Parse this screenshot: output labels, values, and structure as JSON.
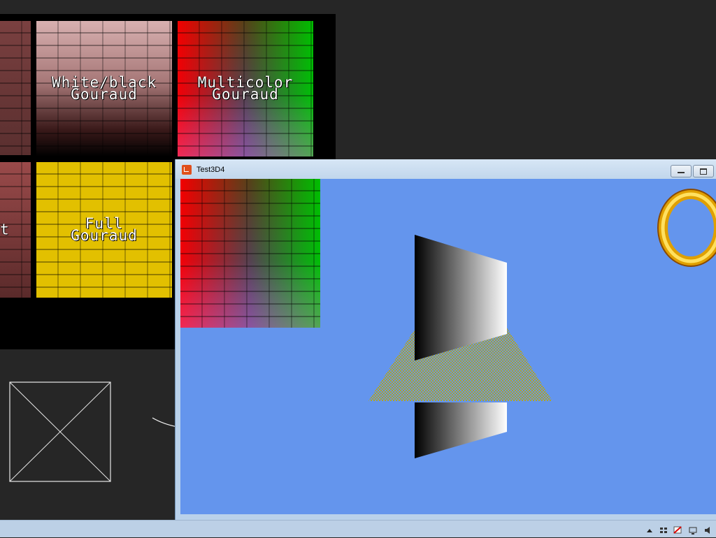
{
  "gallery": {
    "tiles": [
      {
        "id": "partial-top",
        "label": ""
      },
      {
        "id": "white-black",
        "label": "White/black\nGouraud"
      },
      {
        "id": "multicolor",
        "label": "Multicolor\nGouraud"
      },
      {
        "id": "partial-bottom",
        "label": "t"
      },
      {
        "id": "full",
        "label": "Full\nGouraud"
      }
    ]
  },
  "window": {
    "title": "Test3D4",
    "buttons": [
      "minimize",
      "maximize"
    ],
    "viewport_color": "#6495ed"
  },
  "colors": {
    "desktop": "#262626",
    "accent_window": "#b9d1ea",
    "icon_orange": "#e04f1c",
    "checker_a": "#6495ed",
    "checker_b": "#b0a424"
  },
  "icons": [
    "app-icon",
    "minimize-icon",
    "maximize-icon",
    "placeholder-image-icon",
    "ring-sprite",
    "tray-icons"
  ]
}
